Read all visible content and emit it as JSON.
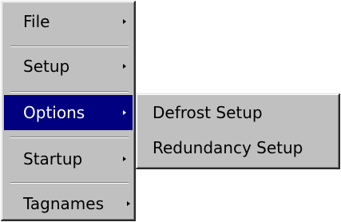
{
  "main_menu": {
    "items": [
      {
        "label": "File",
        "has_submenu": true
      },
      {
        "label": "Setup",
        "has_submenu": true
      },
      {
        "label": "Options",
        "has_submenu": true,
        "selected": true
      },
      {
        "label": "Startup",
        "has_submenu": true
      },
      {
        "label": "Tagnames",
        "has_submenu": true
      }
    ]
  },
  "options_submenu": {
    "items": [
      {
        "label": "Defrost Setup"
      },
      {
        "label": "Redundancy Setup"
      }
    ]
  },
  "colors": {
    "menu_background": "#c0c0c0",
    "selection_background": "#000080",
    "selection_text": "#ffffff",
    "text": "#000000"
  },
  "icons": {
    "submenu_arrow": "chevron-right-icon"
  }
}
